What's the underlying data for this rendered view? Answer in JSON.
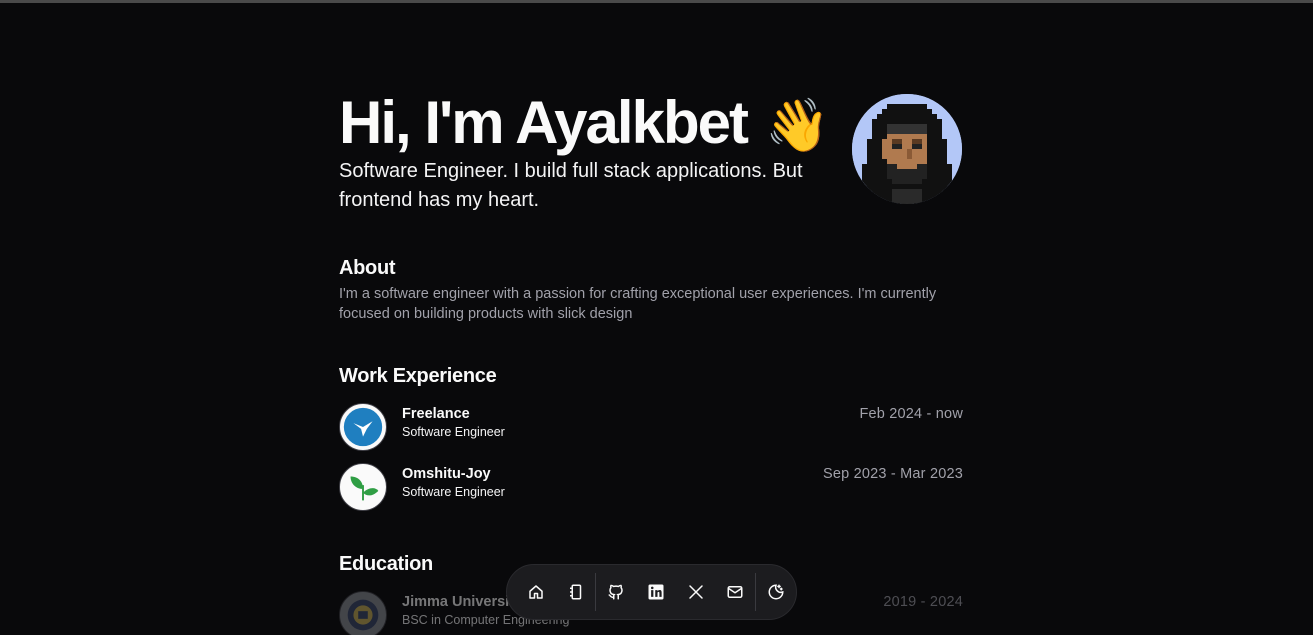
{
  "hero": {
    "greeting": "Hi, I'm Ayalkbet",
    "wave_emoji": "👋",
    "subtitle": "Software Engineer. I build full stack applications. But frontend has my heart.",
    "avatar_icon": "pixel-avatar"
  },
  "about": {
    "title": "About",
    "text": "I'm a software engineer with a passion for crafting exceptional user experiences. I'm currently focused on building products with slick design"
  },
  "work": {
    "title": "Work Experience",
    "items": [
      {
        "name": "Freelance",
        "role": "Software Engineer",
        "dates": "Feb 2024 - now",
        "logo_icon": "bird-logo-icon",
        "logo_color": "#1f7fc0"
      },
      {
        "name": "Omshitu-Joy",
        "role": "Software Engineer",
        "dates": "Sep 2023 - Mar 2023",
        "logo_icon": "leaf-logo-icon",
        "logo_color": "#2f9e44"
      }
    ]
  },
  "education": {
    "title": "Education",
    "items": [
      {
        "name": "Jimma Universi",
        "role": "BSC in Computer Engineering",
        "dates": "2019 - 2024",
        "logo_icon": "university-seal-icon"
      }
    ]
  },
  "dock": {
    "items": [
      {
        "icon": "home-icon"
      },
      {
        "icon": "notebook-icon"
      },
      {
        "icon": "github-icon"
      },
      {
        "icon": "linkedin-icon"
      },
      {
        "icon": "x-icon"
      },
      {
        "icon": "mail-icon"
      },
      {
        "icon": "theme-toggle-icon"
      }
    ]
  },
  "colors": {
    "background": "#09090b",
    "text": "#fafafa",
    "muted": "#a1a1aa",
    "avatar_bg": "#b3c7f7"
  }
}
